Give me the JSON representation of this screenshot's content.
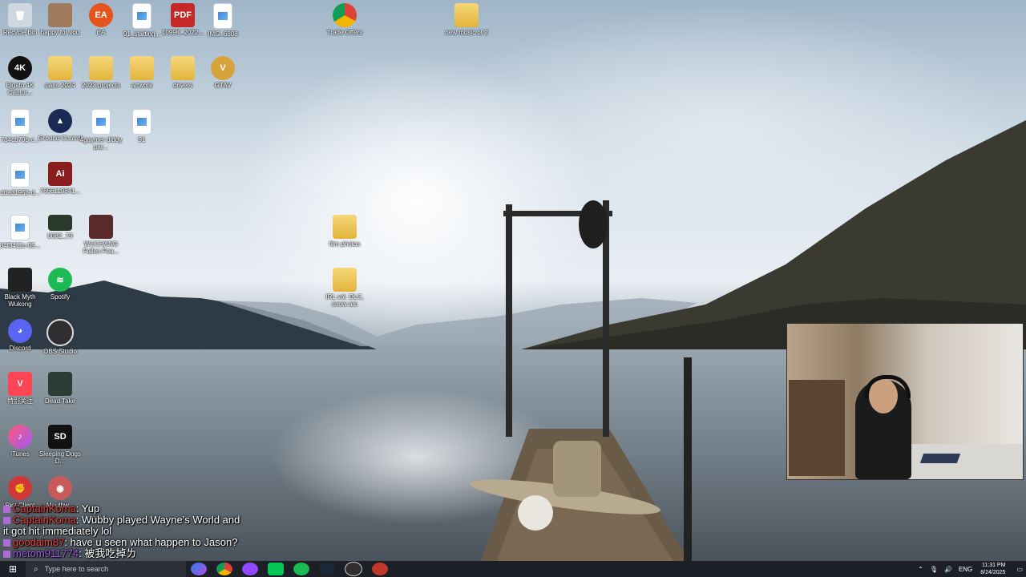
{
  "desktop": {
    "icons": [
      {
        "label": "Recycle Bin",
        "icon": "recycle-bin-icon"
      },
      {
        "label": "happy for you",
        "icon": "image-file-icon"
      },
      {
        "label": "EA",
        "icon": "ea-app-icon"
      },
      {
        "label": "91_starting...",
        "icon": "image-file-icon"
      },
      {
        "label": "1099K_2022...",
        "icon": "pdf-file-icon"
      },
      {
        "label": "IMG_6808",
        "icon": "image-file-icon"
      },
      {
        "label": "Trade Offers",
        "icon": "chrome-shortcut-icon"
      },
      {
        "label": "new music pt 2",
        "icon": "folder-icon"
      },
      {
        "label": "Elgato 4K Captur...",
        "icon": "elgato-4k-icon"
      },
      {
        "label": "paris 2024",
        "icon": "folder-icon"
      },
      {
        "label": "2023 projects",
        "icon": "folder-icon"
      },
      {
        "label": "artwork",
        "icon": "folder-icon"
      },
      {
        "label": "drivers",
        "icon": "folder-icon"
      },
      {
        "label": "GTAV",
        "icon": "gtav-icon"
      },
      {
        "label": "7d4cb70b-c...",
        "icon": "image-file-icon"
      },
      {
        "label": "Ground Control",
        "icon": "ground-control-icon"
      },
      {
        "label": "4gaymer diddy par...",
        "icon": "image-file-icon"
      },
      {
        "label": "91",
        "icon": "image-file-icon"
      },
      {
        "label": "dda31968-d...",
        "icon": "image-file-icon"
      },
      {
        "label": "7656119841...",
        "icon": "adobe-file-icon"
      },
      {
        "label": "84f3411c-05...",
        "icon": "image-file-icon"
      },
      {
        "label": "0082_79",
        "icon": "video-file-icon"
      },
      {
        "label": "WUCHANG Fallen Fea...",
        "icon": "wuchang-game-icon"
      },
      {
        "label": "film photos",
        "icon": "folder-icon"
      },
      {
        "label": "Black Myth Wukong",
        "icon": "black-myth-wukong-icon"
      },
      {
        "label": "Spotify",
        "icon": "spotify-icon"
      },
      {
        "label": "IRL vol. DLC, snow arc",
        "icon": "folder-icon"
      },
      {
        "label": "Discord",
        "icon": "discord-icon"
      },
      {
        "label": "OBS Studio",
        "icon": "obs-studio-icon"
      },
      {
        "label": "特别关注",
        "icon": "valorant-icon"
      },
      {
        "label": "Dead Take",
        "icon": "dead-take-game-icon"
      },
      {
        "label": "iTunes",
        "icon": "itunes-icon"
      },
      {
        "label": "Sleeping Dogs D...",
        "icon": "sleeping-dogs-icon"
      },
      {
        "label": "Riot Client",
        "icon": "riot-client-icon"
      },
      {
        "label": "Mouthw...",
        "icon": "mouthwashing-game-icon"
      }
    ]
  },
  "chat": {
    "messages": [
      {
        "user": "CaptainKoma",
        "text": ": Yup",
        "user_color": "#e8413a"
      },
      {
        "user": "CaptainKoma",
        "text": ": Wubby played Wayne's World and it got hit immediately lol",
        "user_color": "#e8413a"
      },
      {
        "user": "goodaim87",
        "text": ": have u seen what happen to Jason?",
        "user_color": "#e8413a"
      },
      {
        "user": "metom911774",
        "text": ": 被我吃掉ㄌ",
        "user_color": "#9b59e6"
      }
    ]
  },
  "taskbar": {
    "search_placeholder": "Type here to search",
    "pinned": [
      "copilot-icon",
      "chrome-icon",
      "twitch-icon",
      "line-icon",
      "spotify-icon",
      "steam-icon",
      "obs-icon",
      "record-icon"
    ],
    "tray": {
      "language": "ENG",
      "time": "11:31 PM",
      "date": "8/24/2025"
    }
  },
  "colors": {
    "taskbar_bg": "#1c1f26",
    "folder": "#e2b43b",
    "chat_user": "#e8413a"
  }
}
